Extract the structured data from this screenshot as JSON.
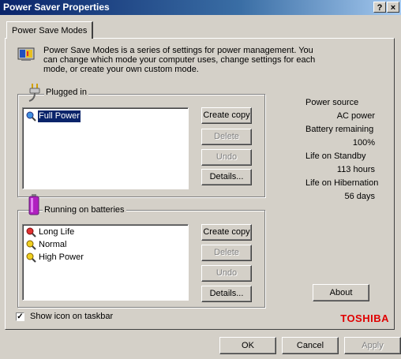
{
  "window": {
    "title": "Power Saver Properties",
    "help_glyph": "?",
    "close_glyph": "×"
  },
  "tabs": [
    {
      "label": "Power Save Modes"
    }
  ],
  "intro": "Power Save Modes is a series of settings for power management. You can change which mode your computer uses, change settings for each mode, or create your own custom mode.",
  "plugged_in": {
    "label": "Plugged in",
    "items": [
      {
        "label": "Full Power",
        "selected": true,
        "icon": "magnifier-blue-icon"
      }
    ],
    "buttons": {
      "create_copy": "Create copy",
      "delete": "Delete",
      "undo": "Undo",
      "details": "Details..."
    }
  },
  "batteries": {
    "label": "Running on batteries",
    "items": [
      {
        "label": "Long Life",
        "icon": "magnifier-red-icon"
      },
      {
        "label": "Normal",
        "icon": "magnifier-yellow-icon"
      },
      {
        "label": "High Power",
        "icon": "magnifier-yellow-icon"
      }
    ],
    "buttons": {
      "create_copy": "Create copy",
      "delete": "Delete",
      "undo": "Undo",
      "details": "Details..."
    }
  },
  "status": {
    "power_source_label": "Power source",
    "power_source_value": "AC power",
    "battery_label": "Battery remaining",
    "battery_value": "100%",
    "standby_label": "Life on Standby",
    "standby_value": "113 hours",
    "hibernation_label": "Life on Hibernation",
    "hibernation_value": "56 days"
  },
  "about_label": "About",
  "show_icon": {
    "label": "Show icon on taskbar",
    "checked": true
  },
  "brand": "TOSHIBA",
  "footer": {
    "ok": "OK",
    "cancel": "Cancel",
    "apply": "Apply"
  },
  "colors": {
    "title_bar": "#0a246a",
    "dialog_bg": "#d4d0c8",
    "selection": "#0a246a",
    "brand_red": "#e00000"
  }
}
